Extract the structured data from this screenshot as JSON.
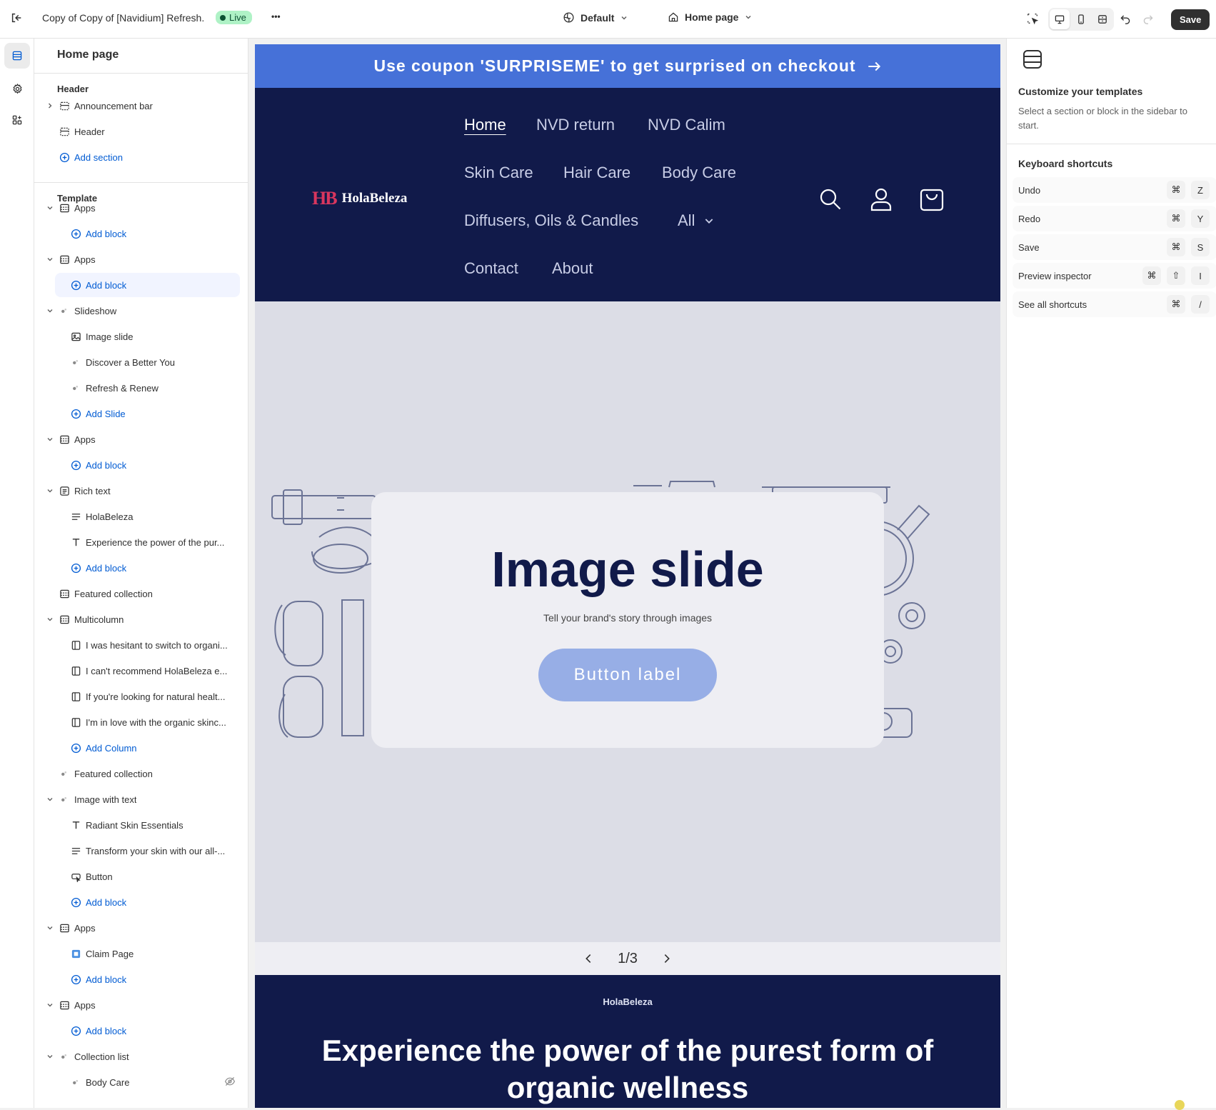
{
  "topbar": {
    "theme_name": "Copy of Copy of [Navidium] Refresh.",
    "live_label": "Live",
    "more_label": "•••",
    "theme_select": "Default",
    "page_select": "Home page",
    "save_label": "Save"
  },
  "sidebar": {
    "title": "Home page",
    "header_group": "Header",
    "header_rows": [
      {
        "label": "Announcement bar"
      },
      {
        "label": "Header"
      },
      {
        "label": "Add section"
      }
    ],
    "template_group": "Template",
    "rows": [
      {
        "label": "Apps"
      },
      {
        "label": "Add block"
      },
      {
        "label": "Apps"
      },
      {
        "label": "Add block"
      },
      {
        "label": "Slideshow"
      },
      {
        "label": "Image slide"
      },
      {
        "label": "Discover a Better You"
      },
      {
        "label": "Refresh & Renew"
      },
      {
        "label": "Add Slide"
      },
      {
        "label": "Apps"
      },
      {
        "label": "Add block"
      },
      {
        "label": "Rich text"
      },
      {
        "label": "HolaBeleza"
      },
      {
        "label": "Experience the power of the pur..."
      },
      {
        "label": "Add block"
      },
      {
        "label": "Featured collection"
      },
      {
        "label": "Multicolumn"
      },
      {
        "label": "I was hesitant to switch to organi..."
      },
      {
        "label": "I can't recommend HolaBeleza e..."
      },
      {
        "label": "If you're looking for natural healt..."
      },
      {
        "label": "I'm in love with the organic skinc..."
      },
      {
        "label": "Add Column"
      },
      {
        "label": "Featured collection"
      },
      {
        "label": "Image with text"
      },
      {
        "label": "Radiant Skin Essentials"
      },
      {
        "label": "Transform your skin with our all-..."
      },
      {
        "label": "Button"
      },
      {
        "label": "Add block"
      },
      {
        "label": "Apps"
      },
      {
        "label": "Claim Page"
      },
      {
        "label": "Add block"
      },
      {
        "label": "Apps"
      },
      {
        "label": "Add block"
      },
      {
        "label": "Collection list"
      },
      {
        "label": "Body Care"
      }
    ]
  },
  "preview": {
    "announcement": "Use coupon 'SURPRISEME' to get surprised on checkout",
    "logo_mark": "HB",
    "logo_text": "HolaBeleza",
    "nav": [
      "Home",
      "NVD return",
      "NVD Calim",
      "Skin Care",
      "Hair Care",
      "Body Care",
      "Diffusers, Oils & Candles",
      "All",
      "Contact",
      "About"
    ],
    "slide_title": "Image slide",
    "slide_subtitle": "Tell your brand's story through images",
    "slide_button": "Button label",
    "slide_counter": "1/3",
    "rich_caption": "HolaBeleza",
    "rich_heading": "Experience the power of the purest form of organic wellness"
  },
  "right_panel": {
    "title": "Customize your templates",
    "desc": "Select a section or block in the sidebar to start.",
    "shortcuts_title": "Keyboard shortcuts",
    "shortcuts": [
      {
        "name": "Undo",
        "keys": [
          "⌘",
          "Z"
        ]
      },
      {
        "name": "Redo",
        "keys": [
          "⌘",
          "Y"
        ]
      },
      {
        "name": "Save",
        "keys": [
          "⌘",
          "S"
        ]
      },
      {
        "name": "Preview inspector",
        "keys": [
          "⌘",
          "⇧",
          "I"
        ]
      },
      {
        "name": "See all shortcuts",
        "keys": [
          "⌘",
          "/"
        ]
      }
    ]
  },
  "colors": {
    "announcement_bg": "#4671d8",
    "header_bg": "#111a4a",
    "hero_bg": "#dcdde6",
    "link_blue": "#005bd3",
    "live_badge": "#aff2c6"
  }
}
